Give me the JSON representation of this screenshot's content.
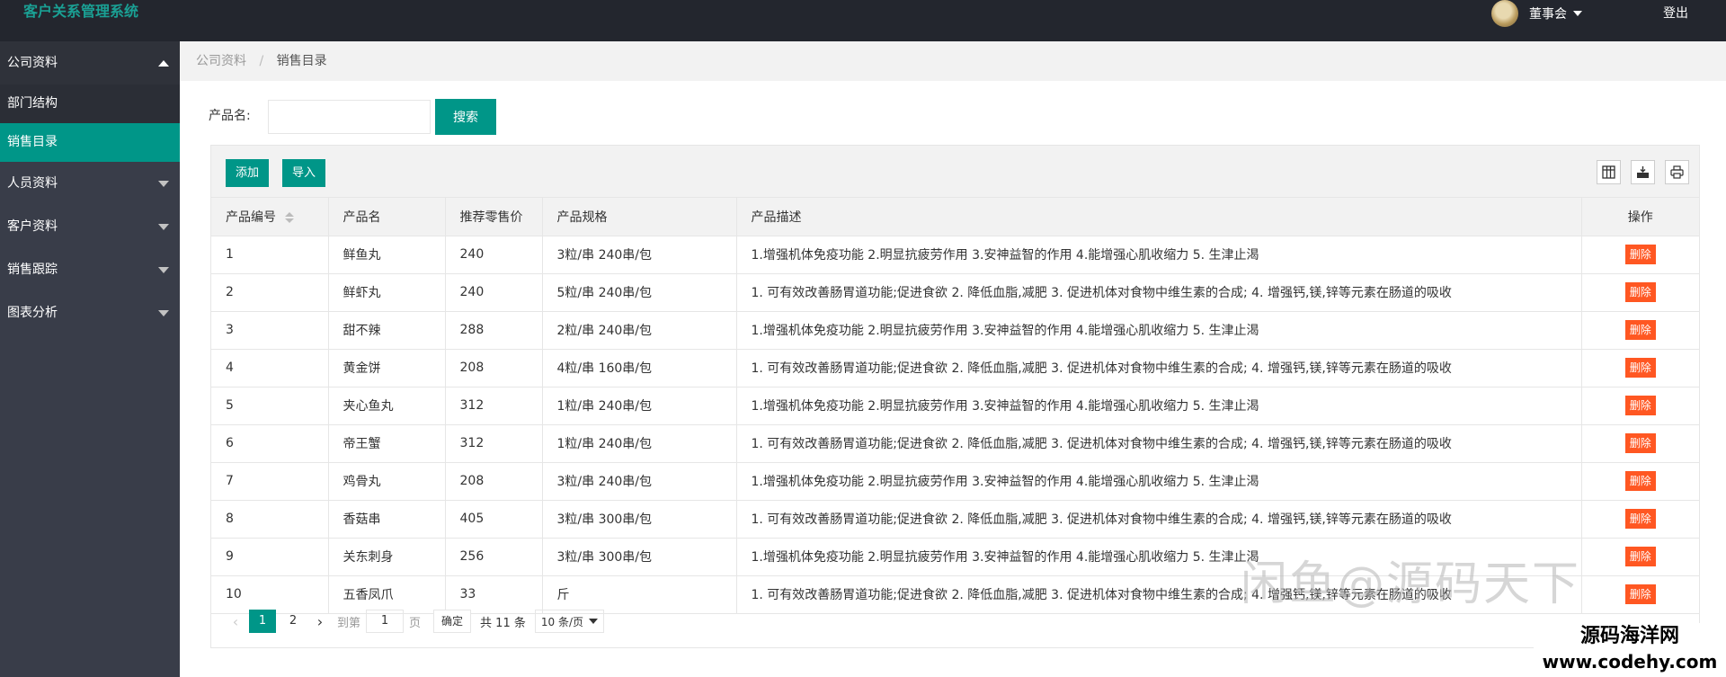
{
  "app": {
    "title": "客户关系管理系统"
  },
  "user": {
    "name": "董事会",
    "logout": "登出"
  },
  "sidebar": {
    "items": [
      {
        "label": "公司资料",
        "open": true,
        "children": [
          {
            "label": "部门结构"
          },
          {
            "label": "销售目录",
            "active": true
          }
        ]
      },
      {
        "label": "人员资料"
      },
      {
        "label": "客户资料"
      },
      {
        "label": "销售跟踪"
      },
      {
        "label": "图表分析"
      }
    ]
  },
  "breadcrumb": {
    "parent": "公司资料",
    "sep": "/",
    "current": "销售目录"
  },
  "search": {
    "label": "产品名:",
    "value": "",
    "button": "搜索"
  },
  "toolbar": {
    "add": "添加",
    "import": "导入"
  },
  "table": {
    "columns": [
      "产品编号",
      "产品名",
      "推荐零售价",
      "产品规格",
      "产品描述",
      "操作"
    ],
    "delete_label": "删除",
    "rows": [
      [
        "1",
        "鲜鱼丸",
        "240",
        "3粒/串 240串/包",
        "1.增强机体免疫功能 2.明显抗疲劳作用 3.安神益智的作用 4.能增强心肌收缩力 5. 生津止渴"
      ],
      [
        "2",
        "鲜虾丸",
        "240",
        "5粒/串 240串/包",
        "1. 可有效改善肠胃道功能;促进食欲 2. 降低血脂,减肥 3. 促进机体对食物中维生素的合成; 4. 增强钙,镁,锌等元素在肠道的吸收"
      ],
      [
        "3",
        "甜不辣",
        "288",
        "2粒/串 240串/包",
        "1.增强机体免疫功能 2.明显抗疲劳作用 3.安神益智的作用 4.能增强心肌收缩力 5. 生津止渴"
      ],
      [
        "4",
        "黄金饼",
        "208",
        "4粒/串 160串/包",
        "1. 可有效改善肠胃道功能;促进食欲 2. 降低血脂,减肥 3. 促进机体对食物中维生素的合成; 4. 增强钙,镁,锌等元素在肠道的吸收"
      ],
      [
        "5",
        "夹心鱼丸",
        "312",
        "1粒/串 240串/包",
        "1.增强机体免疫功能 2.明显抗疲劳作用 3.安神益智的作用 4.能增强心肌收缩力 5. 生津止渴"
      ],
      [
        "6",
        "帝王蟹",
        "312",
        "1粒/串 240串/包",
        "1. 可有效改善肠胃道功能;促进食欲 2. 降低血脂,减肥 3. 促进机体对食物中维生素的合成; 4. 增强钙,镁,锌等元素在肠道的吸收"
      ],
      [
        "7",
        "鸡骨丸",
        "208",
        "3粒/串 240串/包",
        "1.增强机体免疫功能 2.明显抗疲劳作用 3.安神益智的作用 4.能增强心肌收缩力 5. 生津止渴"
      ],
      [
        "8",
        "香菇串",
        "405",
        "3粒/串 300串/包",
        "1. 可有效改善肠胃道功能;促进食欲 2. 降低血脂,减肥 3. 促进机体对食物中维生素的合成; 4. 增强钙,镁,锌等元素在肠道的吸收"
      ],
      [
        "9",
        "关东刺身",
        "256",
        "3粒/串 300串/包",
        "1.增强机体免疫功能 2.明显抗疲劳作用 3.安神益智的作用 4.能增强心肌收缩力 5. 生津止渴"
      ],
      [
        "10",
        "五香凤爪",
        "33",
        "斤",
        "1. 可有效改善肠胃道功能;促进食欲 2. 降低血脂,减肥 3. 促进机体对食物中维生素的合成; 4. 增强钙,镁,锌等元素在肠道的吸收"
      ]
    ]
  },
  "pager": {
    "pages": [
      "1",
      "2"
    ],
    "current": "1",
    "goto_label": "到第",
    "goto_value": "1",
    "page_unit": "页",
    "ok": "确定",
    "total": "共 11 条",
    "page_size": "10 条/页"
  },
  "watermark": {
    "text": "闲鱼@源码天下",
    "badge_line1": "源码海洋网",
    "badge_line2": "www.codehy.com"
  },
  "colors": {
    "header": "#23262e",
    "sidebar": "#393d49",
    "accent": "#009688",
    "danger": "#ff5722"
  }
}
